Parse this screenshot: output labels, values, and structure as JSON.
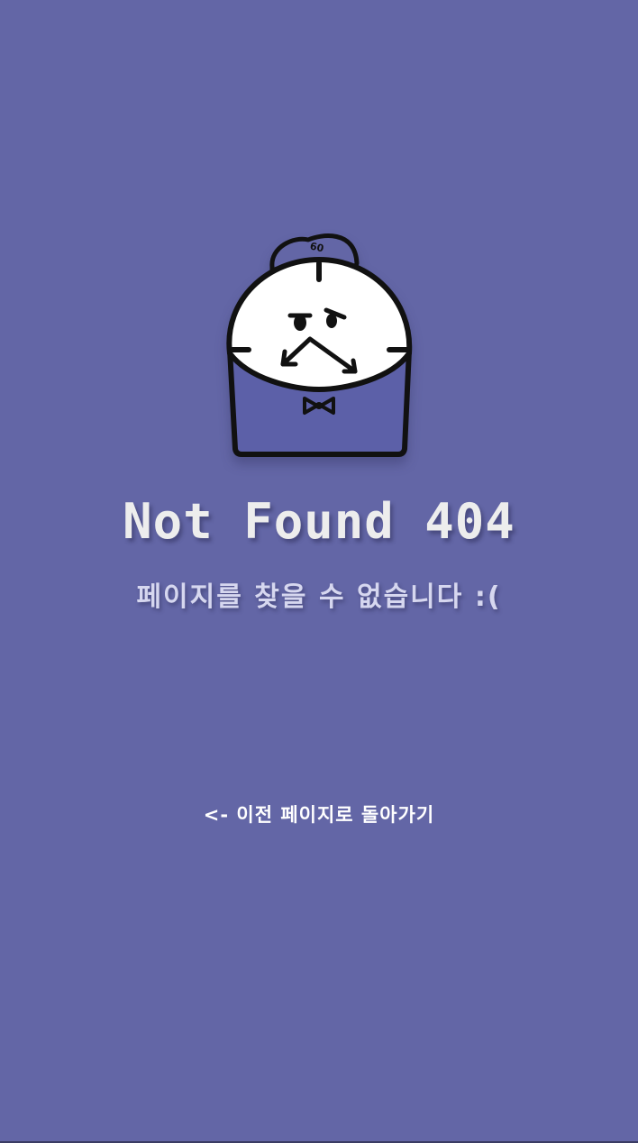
{
  "mascot": {
    "cap_text": "60"
  },
  "title": "Not Found 404",
  "subtitle": "페이지를 찾을 수 없습니다 :(",
  "back_link": "<- 이전 페이지로 돌아가기",
  "colors": {
    "background": "#6366a6",
    "title": "#ededed",
    "subtitle": "#d6d7ef",
    "link": "#ffffff"
  }
}
